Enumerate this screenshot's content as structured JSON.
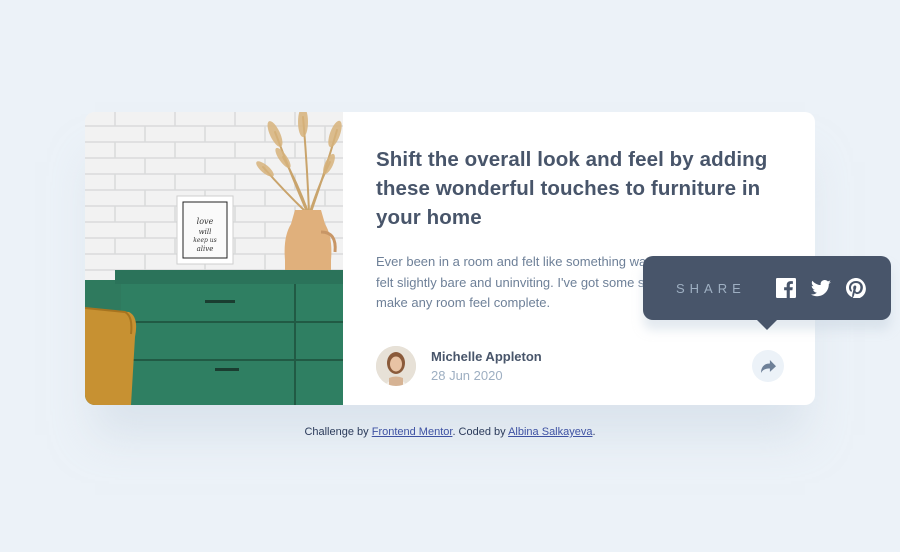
{
  "article": {
    "title": "Shift the overall look and feel by adding these wonderful touches to furniture in your home",
    "description": "Ever been in a room and felt like something was missing? Perhaps it felt slightly bare and uninviting. I've got some simple tips to help you make any room feel complete."
  },
  "image": {
    "frame_text": "love will keep us alive"
  },
  "author": {
    "name": "Michelle Appleton",
    "date": "28 Jun 2020"
  },
  "share": {
    "label": "SHARE",
    "icons": [
      "facebook-icon",
      "twitter-icon",
      "pinterest-icon",
      "share-icon"
    ]
  },
  "attribution": {
    "prefix": "Challenge by",
    "mentor_link": "Frontend Mentor",
    "middle": ". Coded by",
    "author_link": "Albina Salkayeva",
    "suffix": "."
  },
  "colors": {
    "background": "#ecf2f8",
    "title": "#48556a",
    "text": "#6e8098",
    "muted": "#9eafc2",
    "tooltip": "#48556a",
    "drawer": "#2f7a5e"
  }
}
